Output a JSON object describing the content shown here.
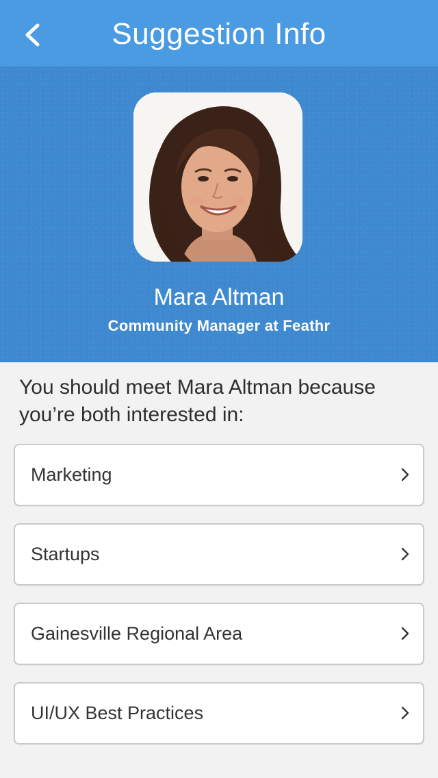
{
  "nav": {
    "title": "Suggestion Info",
    "back_icon": "chevron-left-icon"
  },
  "profile": {
    "name": "Mara Altman",
    "role": "Community Manager at Feathr",
    "avatar_alt": "Mara Altman"
  },
  "reason": {
    "text": "You should meet Mara Altman because you’re both interested in:"
  },
  "interests": [
    {
      "label": "Marketing",
      "icon": "chevron-right-icon"
    },
    {
      "label": "Startups",
      "icon": "chevron-right-icon"
    },
    {
      "label": "Gainesville Regional Area",
      "icon": "chevron-right-icon"
    },
    {
      "label": "UI/UX Best Practices",
      "icon": "chevron-right-icon"
    }
  ],
  "colors": {
    "nav_bar": "#4a9be2",
    "header_background": "#3e89d0",
    "page_background": "#f2f2f2",
    "text_dark": "#2e2e2e"
  }
}
